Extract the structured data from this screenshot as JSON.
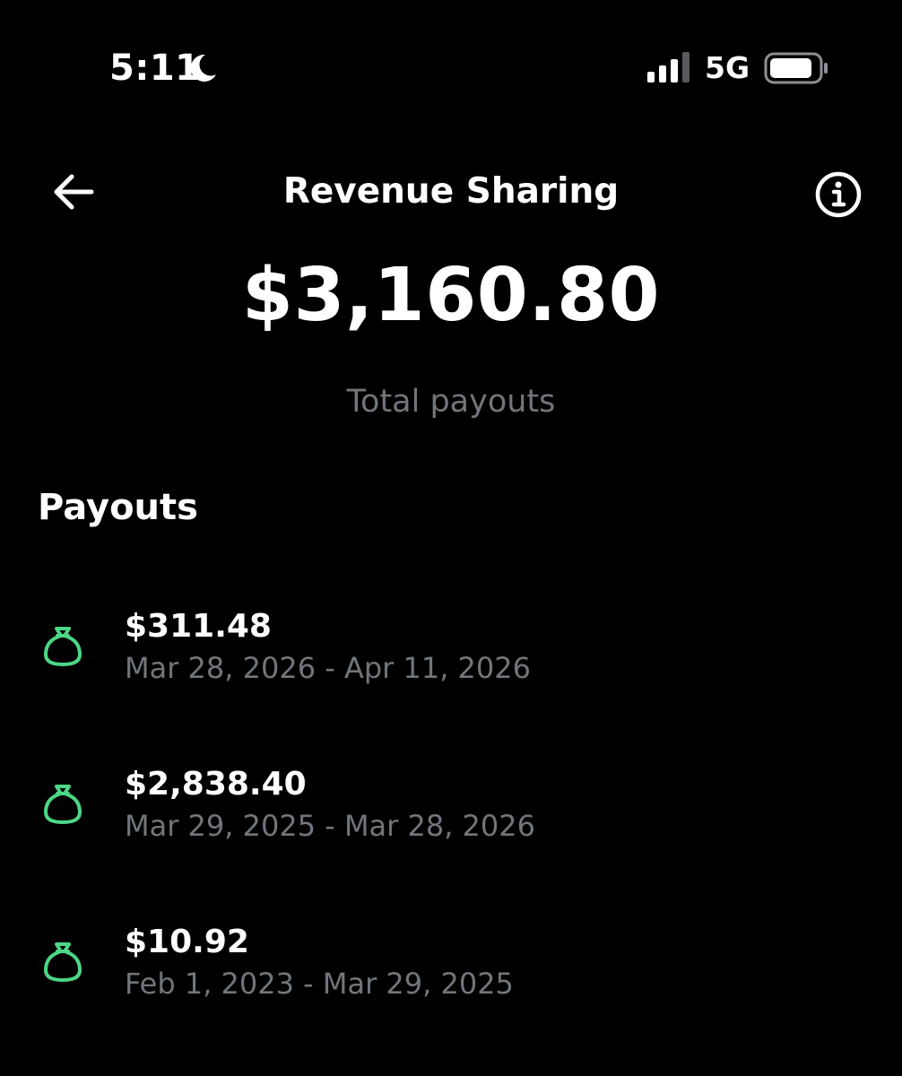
{
  "status_bar": {
    "time": "5:11",
    "focus_icon": "moon-icon",
    "signal_icon": "cellular-signal-icon",
    "network": "5G",
    "battery_icon": "battery-icon"
  },
  "header": {
    "back_icon": "back-arrow-icon",
    "title": "Revenue Sharing",
    "info_icon": "info-icon"
  },
  "summary": {
    "total": "$3,160.80",
    "label": "Total payouts"
  },
  "payouts": {
    "heading": "Payouts",
    "icon": "moneybag-icon",
    "accent_color": "#4cd786",
    "items": [
      {
        "amount": "$311.48",
        "period": "Mar 28, 2026 - Apr 11, 2026"
      },
      {
        "amount": "$2,838.40",
        "period": "Mar 29, 2025 - Mar 28, 2026"
      },
      {
        "amount": "$10.92",
        "period": "Feb 1, 2023 - Mar 29, 2025"
      }
    ]
  },
  "colors": {
    "background": "#000000",
    "text_primary": "#ffffff",
    "text_secondary": "#71767b"
  }
}
